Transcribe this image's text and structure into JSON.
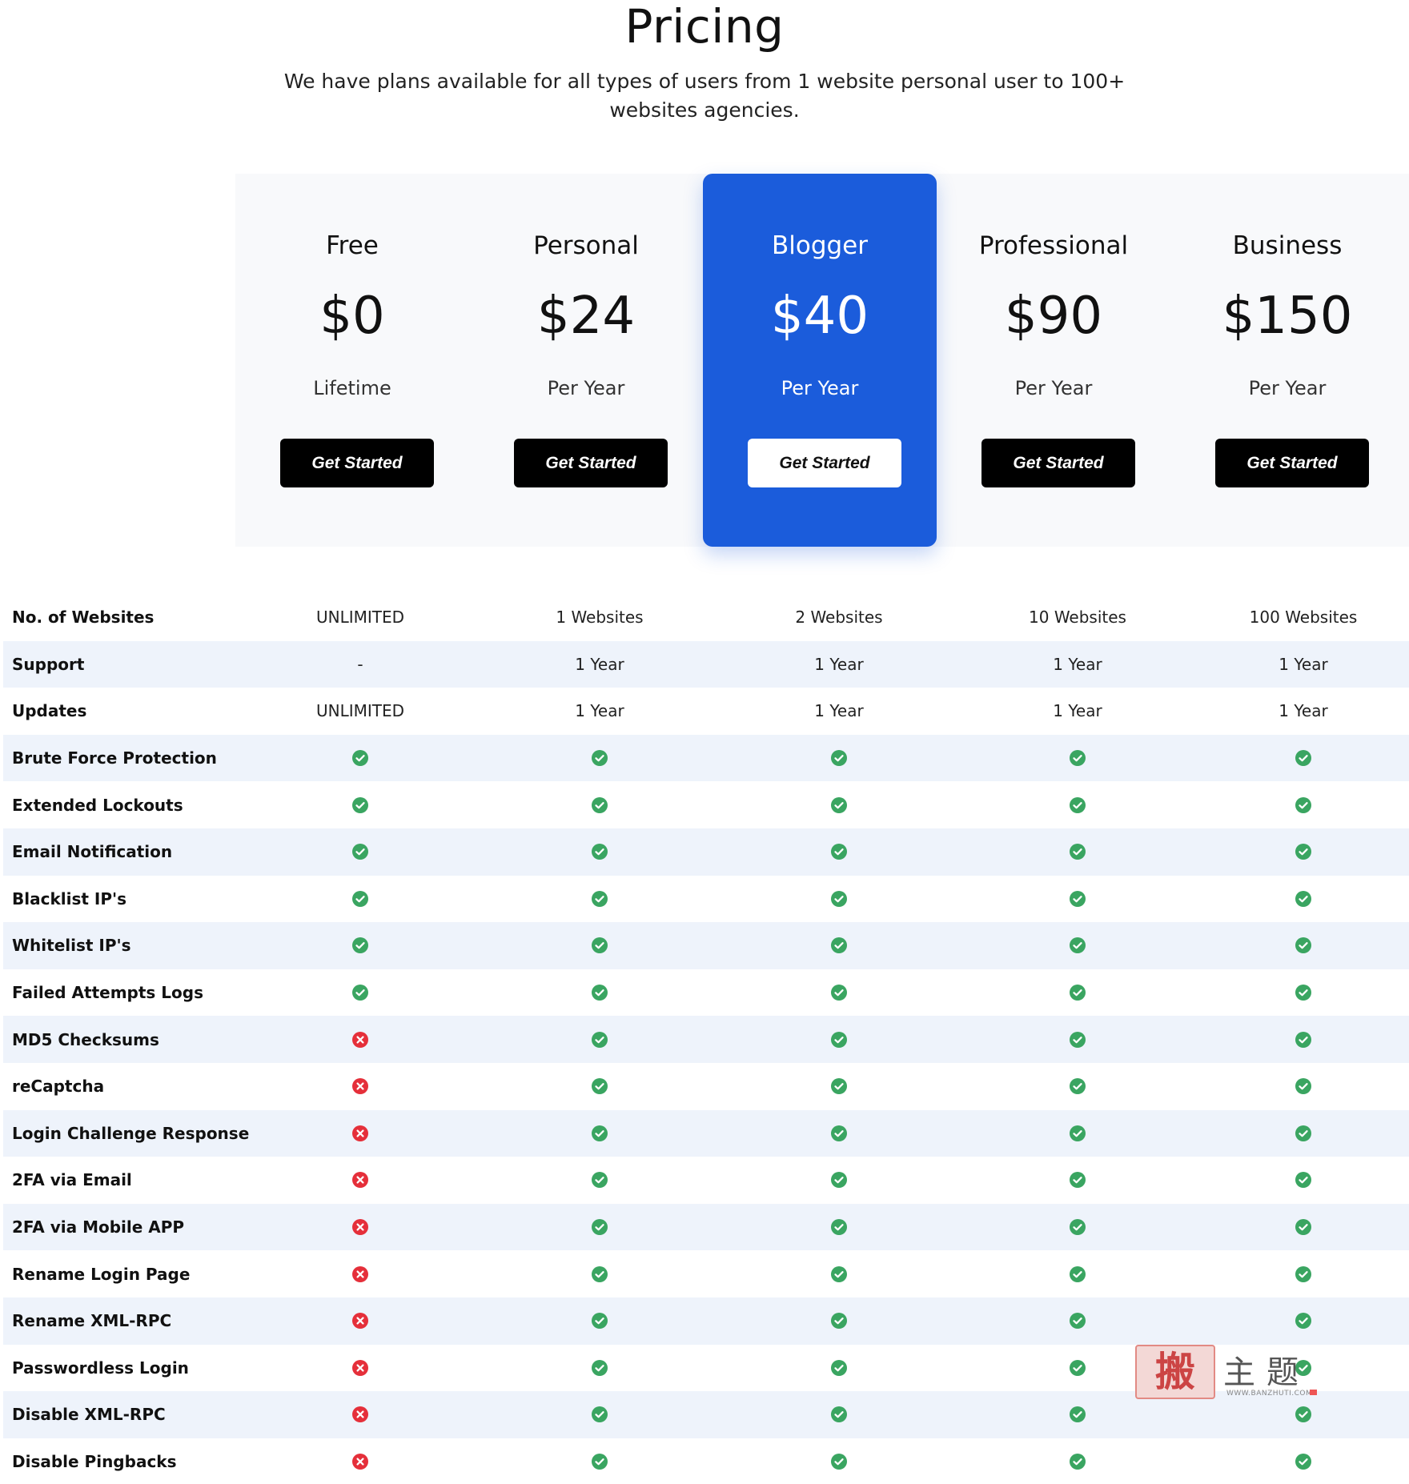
{
  "header": {
    "title": "Pricing",
    "subtitle": "We have plans available for all types of users from 1 website personal user to 100+ websites agencies."
  },
  "plans": [
    {
      "name": "Free",
      "price": "$0",
      "period": "Lifetime",
      "cta": "Get Started",
      "featured": false
    },
    {
      "name": "Personal",
      "price": "$24",
      "period": "Per Year",
      "cta": "Get Started",
      "featured": false
    },
    {
      "name": "Blogger",
      "price": "$40",
      "period": "Per Year",
      "cta": "Get Started",
      "featured": true
    },
    {
      "name": "Professional",
      "price": "$90",
      "period": "Per Year",
      "cta": "Get Started",
      "featured": false
    },
    {
      "name": "Business",
      "price": "$150",
      "period": "Per Year",
      "cta": "Get Started",
      "featured": false
    }
  ],
  "features": [
    {
      "label": "No. of Websites",
      "values": [
        "UNLIMITED",
        "1 Websites",
        "2 Websites",
        "10 Websites",
        "100 Websites"
      ]
    },
    {
      "label": "Support",
      "values": [
        "-",
        "1 Year",
        "1 Year",
        "1 Year",
        "1 Year"
      ]
    },
    {
      "label": "Updates",
      "values": [
        "UNLIMITED",
        "1 Year",
        "1 Year",
        "1 Year",
        "1 Year"
      ]
    },
    {
      "label": "Brute Force Protection",
      "values": [
        "yes",
        "yes",
        "yes",
        "yes",
        "yes"
      ]
    },
    {
      "label": "Extended Lockouts",
      "values": [
        "yes",
        "yes",
        "yes",
        "yes",
        "yes"
      ]
    },
    {
      "label": "Email Notification",
      "values": [
        "yes",
        "yes",
        "yes",
        "yes",
        "yes"
      ]
    },
    {
      "label": "Blacklist IP's",
      "values": [
        "yes",
        "yes",
        "yes",
        "yes",
        "yes"
      ]
    },
    {
      "label": "Whitelist IP's",
      "values": [
        "yes",
        "yes",
        "yes",
        "yes",
        "yes"
      ]
    },
    {
      "label": "Failed Attempts Logs",
      "values": [
        "yes",
        "yes",
        "yes",
        "yes",
        "yes"
      ]
    },
    {
      "label": "MD5 Checksums",
      "values": [
        "no",
        "yes",
        "yes",
        "yes",
        "yes"
      ]
    },
    {
      "label": "reCaptcha",
      "values": [
        "no",
        "yes",
        "yes",
        "yes",
        "yes"
      ]
    },
    {
      "label": "Login Challenge Response",
      "values": [
        "no",
        "yes",
        "yes",
        "yes",
        "yes"
      ]
    },
    {
      "label": "2FA via Email",
      "values": [
        "no",
        "yes",
        "yes",
        "yes",
        "yes"
      ]
    },
    {
      "label": "2FA via Mobile APP",
      "values": [
        "no",
        "yes",
        "yes",
        "yes",
        "yes"
      ]
    },
    {
      "label": "Rename Login Page",
      "values": [
        "no",
        "yes",
        "yes",
        "yes",
        "yes"
      ]
    },
    {
      "label": "Rename XML-RPC",
      "values": [
        "no",
        "yes",
        "yes",
        "yes",
        "yes"
      ]
    },
    {
      "label": "Passwordless Login",
      "values": [
        "no",
        "yes",
        "yes",
        "yes",
        "yes"
      ]
    },
    {
      "label": "Disable XML-RPC",
      "values": [
        "no",
        "yes",
        "yes",
        "yes",
        "yes"
      ]
    },
    {
      "label": "Disable Pingbacks",
      "values": [
        "no",
        "yes",
        "yes",
        "yes",
        "yes"
      ]
    }
  ],
  "icons": {
    "yes": "check-circle-icon",
    "no": "x-circle-icon"
  },
  "colors": {
    "featured": "#1b5cdb",
    "check": "#3aa561",
    "cross": "#e52f3a",
    "row_alt": "#eef3fb"
  },
  "watermark": {
    "mark": "搬",
    "text": "主题",
    "url": "WWW.BANZHUTI.COM"
  }
}
